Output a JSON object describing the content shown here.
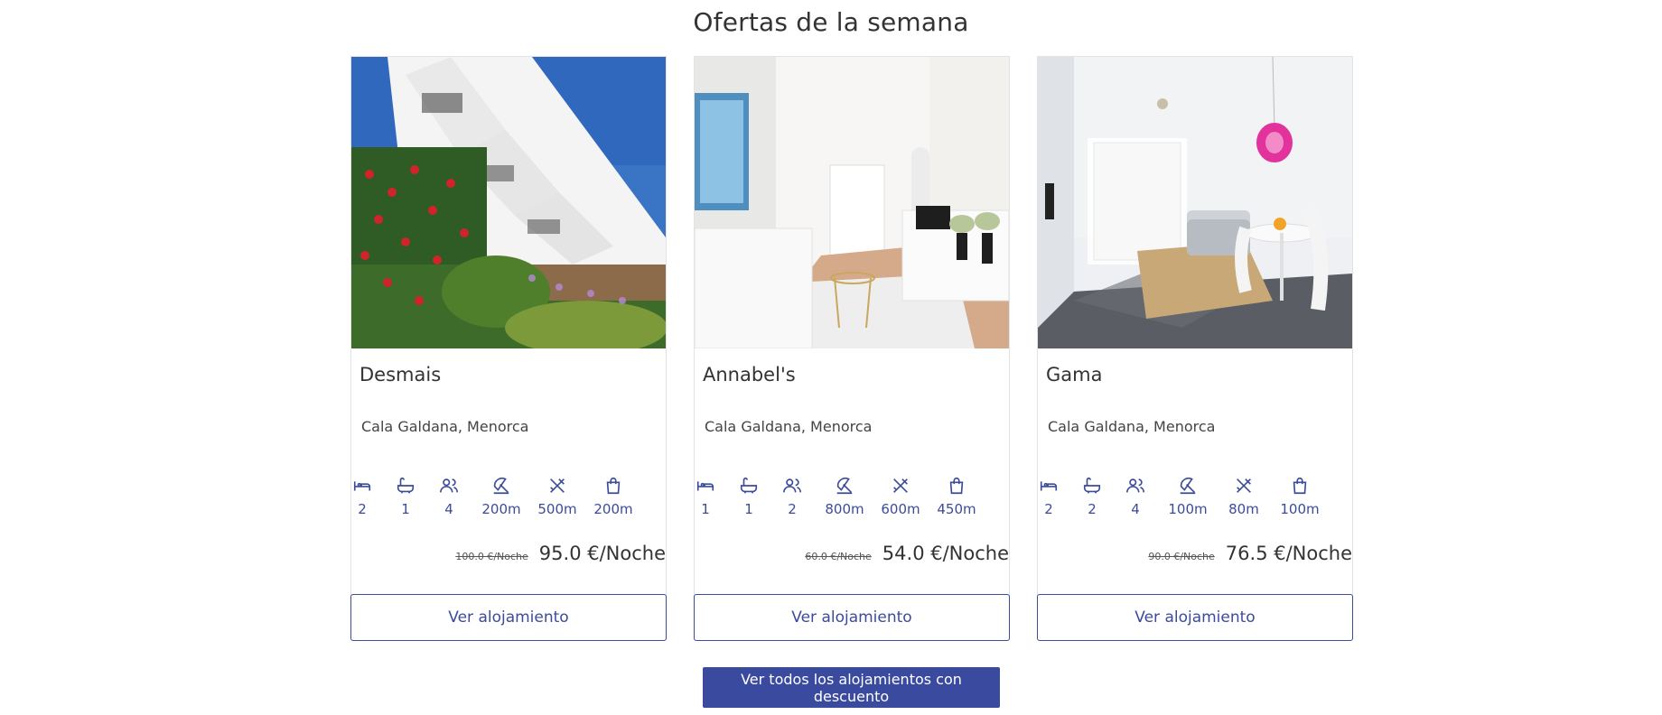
{
  "page": {
    "title": "Ofertas de la semana",
    "view_all_label": "Ver todos los alojamientos con descuento",
    "accent_color": "#3c4c98"
  },
  "amenity_icons": [
    "bed-icon",
    "bathtub-icon",
    "guests-icon",
    "beach-umbrella-icon",
    "restaurant-icon",
    "shopping-bag-icon"
  ],
  "cards": [
    {
      "name": "Desmais",
      "location": "Cala Galdana, Menorca",
      "amenities": [
        "2",
        "1",
        "4",
        "200m",
        "500m",
        "200m"
      ],
      "old_price": "100.0 €/Noche",
      "price": "95.0 €/Noche",
      "button_label": "Ver alojamiento",
      "photo": "building-with-red-flowers"
    },
    {
      "name": "Annabel's",
      "location": "Cala Galdana, Menorca",
      "amenities": [
        "1",
        "1",
        "2",
        "800m",
        "600m",
        "450m"
      ],
      "old_price": "60.0 €/Noche",
      "price": "54.0 €/Noche",
      "button_label": "Ver alojamiento",
      "photo": "white-living-room"
    },
    {
      "name": "Gama",
      "location": "Cala Galdana, Menorca",
      "amenities": [
        "2",
        "2",
        "4",
        "100m",
        "80m",
        "100m"
      ],
      "old_price": "90.0 €/Noche",
      "price": "76.5 €/Noche",
      "button_label": "Ver alojamiento",
      "photo": "dining-room-with-pink-lamp"
    }
  ]
}
